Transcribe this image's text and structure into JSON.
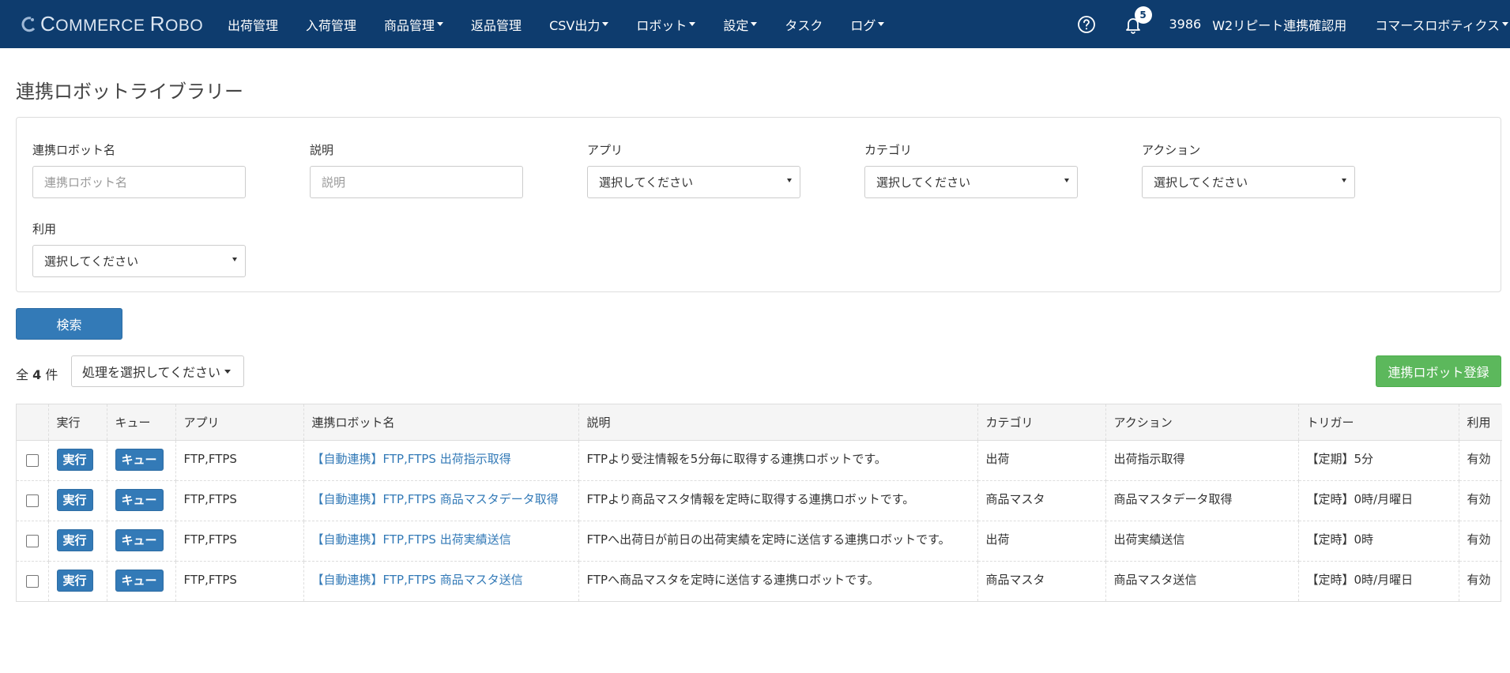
{
  "header": {
    "logo_text_1": "C",
    "logo_text_2": "OMMERCE ",
    "logo_text_3": "R",
    "logo_text_4": "OBO",
    "nav": [
      {
        "label": "出荷管理",
        "dropdown": false
      },
      {
        "label": "入荷管理",
        "dropdown": false
      },
      {
        "label": "商品管理",
        "dropdown": true
      },
      {
        "label": "返品管理",
        "dropdown": false
      },
      {
        "label": "CSV出力",
        "dropdown": true
      },
      {
        "label": "ロボット",
        "dropdown": true
      },
      {
        "label": "設定",
        "dropdown": true
      },
      {
        "label": "タスク",
        "dropdown": false
      },
      {
        "label": "ログ",
        "dropdown": true
      }
    ],
    "notification_count": "5",
    "account_id": "3986",
    "account_name": "W2リピート連携確認用",
    "company": "コマースロボティクス"
  },
  "page": {
    "title": "連携ロボットライブラリー"
  },
  "filters": {
    "robot_name_label": "連携ロボット名",
    "robot_name_placeholder": "連携ロボット名",
    "description_label": "説明",
    "description_placeholder": "説明",
    "app_label": "アプリ",
    "app_value": "選択してください",
    "category_label": "カテゴリ",
    "category_value": "選択してください",
    "action_label": "アクション",
    "action_value": "選択してください",
    "usage_label": "利用",
    "usage_value": "選択してください"
  },
  "search_label": "検索",
  "list": {
    "total_prefix": "全",
    "total_count": "4",
    "total_suffix": "件",
    "bulk_action": "処理を選択してください",
    "register_label": "連携ロボット登録"
  },
  "table": {
    "headers": {
      "run": "実行",
      "queue": "キュー",
      "app": "アプリ",
      "name": "連携ロボット名",
      "description": "説明",
      "category": "カテゴリ",
      "action": "アクション",
      "trigger": "トリガー",
      "usage": "利用"
    },
    "run_label": "実行",
    "queue_label": "キュー",
    "rows": [
      {
        "app": "FTP,FTPS",
        "name": "【自動連携】FTP,FTPS 出荷指示取得",
        "description": "FTPより受注情報を5分毎に取得する連携ロボットです。",
        "category": "出荷",
        "action": "出荷指示取得",
        "trigger": "【定期】5分",
        "usage": "有効"
      },
      {
        "app": "FTP,FTPS",
        "name": "【自動連携】FTP,FTPS 商品マスタデータ取得",
        "description": "FTPより商品マスタ情報を定時に取得する連携ロボットです。",
        "category": "商品マスタ",
        "action": "商品マスタデータ取得",
        "trigger": "【定時】0時/月曜日",
        "usage": "有効"
      },
      {
        "app": "FTP,FTPS",
        "name": "【自動連携】FTP,FTPS 出荷実績送信",
        "description": "FTPへ出荷日が前日の出荷実績を定時に送信する連携ロボットです。",
        "category": "出荷",
        "action": "出荷実績送信",
        "trigger": "【定時】0時",
        "usage": "有効"
      },
      {
        "app": "FTP,FTPS",
        "name": "【自動連携】FTP,FTPS 商品マスタ送信",
        "description": "FTPへ商品マスタを定時に送信する連携ロボットです。",
        "category": "商品マスタ",
        "action": "商品マスタ送信",
        "trigger": "【定時】0時/月曜日",
        "usage": "有効"
      }
    ]
  }
}
